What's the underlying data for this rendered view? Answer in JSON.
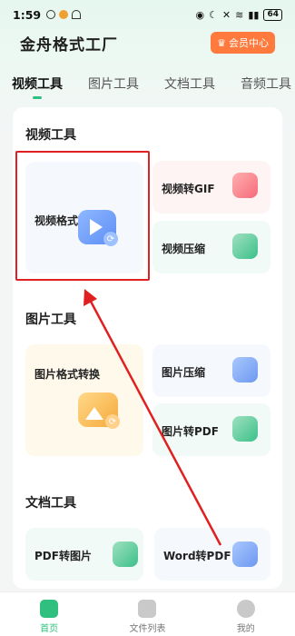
{
  "status": {
    "time": "1:59",
    "battery": "64",
    "signal_text": "⁴ᴳ"
  },
  "header": {
    "title": "金舟格式工厂",
    "vip_label": "会员中心"
  },
  "tabs": [
    {
      "label": "视频工具",
      "active": true
    },
    {
      "label": "图片工具",
      "active": false
    },
    {
      "label": "文档工具",
      "active": false
    },
    {
      "label": "音频工具",
      "active": false
    }
  ],
  "sections": {
    "video": {
      "title": "视频工具",
      "items": [
        {
          "label": "视频格式转换",
          "icon": "video-convert-icon"
        },
        {
          "label": "视频转GIF",
          "icon": "video-to-gif-icon"
        },
        {
          "label": "视频压缩",
          "icon": "video-compress-icon"
        }
      ]
    },
    "image": {
      "title": "图片工具",
      "items": [
        {
          "label": "图片格式转换",
          "icon": "image-convert-icon"
        },
        {
          "label": "图片压缩",
          "icon": "image-compress-icon"
        },
        {
          "label": "图片转PDF",
          "icon": "image-to-pdf-icon"
        }
      ]
    },
    "document": {
      "title": "文档工具",
      "items": [
        {
          "label": "PDF转图片",
          "icon": "pdf-to-image-icon"
        },
        {
          "label": "Word转PDF",
          "icon": "word-to-pdf-icon"
        }
      ]
    }
  },
  "bottom_nav": [
    {
      "label": "首页",
      "icon": "home-icon",
      "active": true
    },
    {
      "label": "文件列表",
      "icon": "folder-icon",
      "active": false
    },
    {
      "label": "我的",
      "icon": "user-icon",
      "active": false
    }
  ],
  "colors": {
    "accent": "#2fbf7f",
    "vip": "#ff7a3c",
    "highlight": "#e02020"
  }
}
